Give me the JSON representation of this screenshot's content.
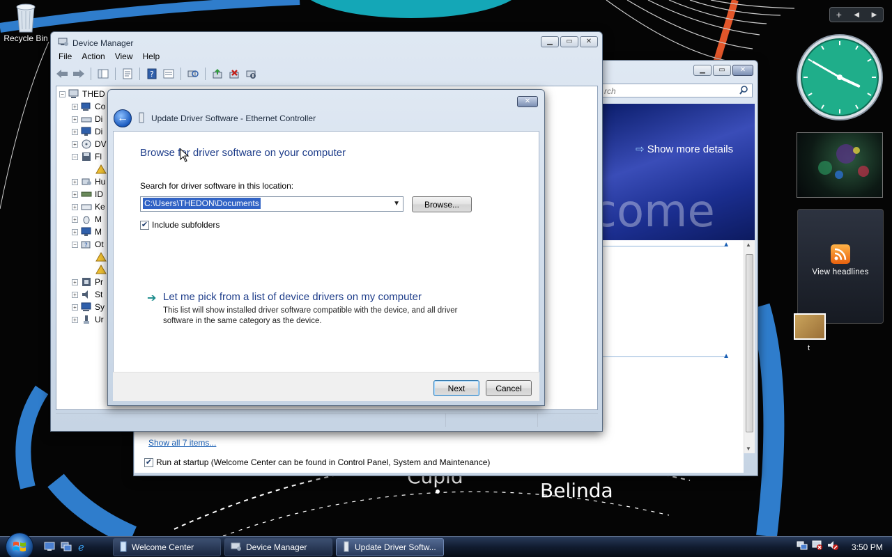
{
  "desktop": {
    "recycle_bin_label": "Recycle Bin",
    "wallpaper_words": [
      "Cupid",
      "Belinda"
    ],
    "photo_caption": "t"
  },
  "welcome_center": {
    "search_placeholder": "rch",
    "banner_link": "Show more details",
    "banner_word": "lcome",
    "show_all": "Show all 7 items...",
    "run_at_startup": "Run at startup (Welcome Center can be found in Control Panel, System and Maintenance)",
    "run_at_startup_checked": true
  },
  "device_manager": {
    "title": "Device Manager",
    "menu": [
      "File",
      "Action",
      "View",
      "Help"
    ],
    "tree_root": "THED",
    "tree_items": [
      "Co",
      "Di",
      "Di",
      "DV",
      "Fl",
      "",
      "Hu",
      "ID",
      "Ke",
      "M",
      "M",
      "Ot",
      "",
      "",
      "Pr",
      "St",
      "Sy",
      "Ur"
    ]
  },
  "wizard": {
    "title": "Update Driver Software - Ethernet Controller",
    "heading": "Browse for driver software on your computer",
    "location_label": "Search for driver software in this location:",
    "location_value": "C:\\Users\\THEDON\\Documents",
    "browse_button": "Browse...",
    "include_subfolders": "Include subfolders",
    "include_subfolders_checked": true,
    "pick_title": "Let me pick from a list of device drivers on my computer",
    "pick_description": "This list will show installed driver software compatible with the device, and all driver software in the same category as the device.",
    "next_button": "Next",
    "cancel_button": "Cancel"
  },
  "gadgets": {
    "feed_label": "View headlines",
    "clock_hour": 3,
    "clock_minute": 50
  },
  "taskbar": {
    "buttons": [
      "Welcome Center",
      "Device Manager",
      "Update Driver Softw..."
    ],
    "active_index": 2,
    "time": "3:50 PM"
  },
  "colors": {
    "wallpaper_blue": "#2f7dcc",
    "wallpaper_orange": "#e2562a",
    "clock_face": "#1fae8a",
    "heading_blue": "#1e3d8a"
  }
}
